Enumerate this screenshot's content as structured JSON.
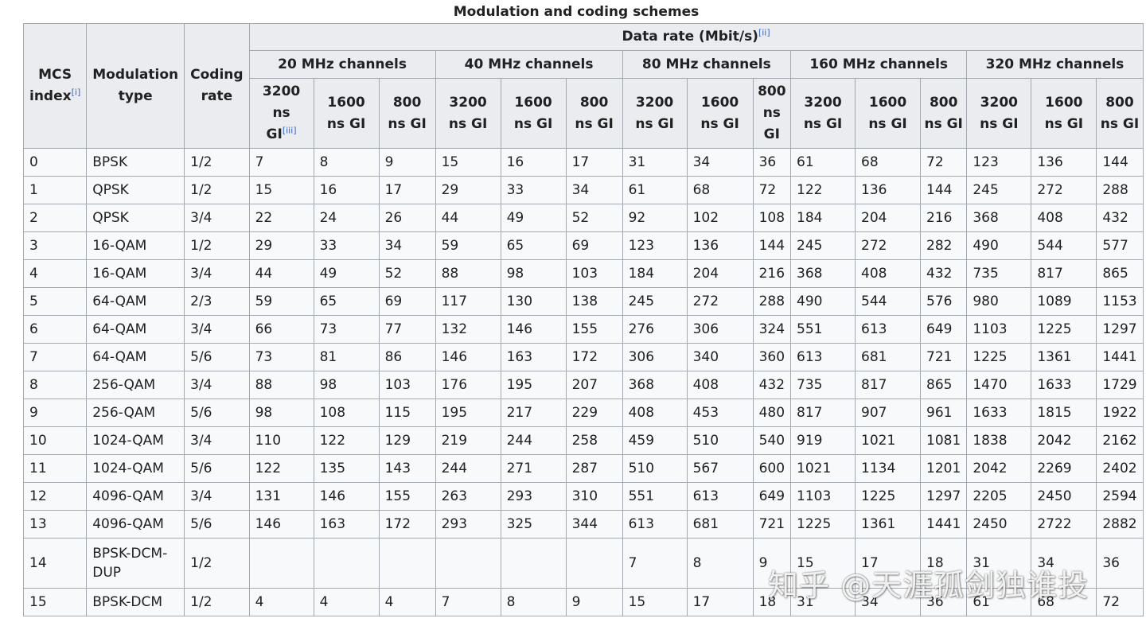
{
  "caption": "Modulation and coding schemes",
  "headers": {
    "mcs_index": "MCS index",
    "mcs_note": "[i]",
    "modulation_type": "Modulation type",
    "coding_rate": "Coding rate",
    "data_rate": "Data rate (Mbit/s)",
    "data_rate_note": "[ii]",
    "channels": [
      "20 MHz channels",
      "40 MHz channels",
      "80 MHz channels",
      "160 MHz channels",
      "320 MHz channels"
    ],
    "gi_3200": "3200 ns GI",
    "gi_3200_note": "[iii]",
    "gi_1600": "1600 ns GI",
    "gi_800": "800 ns GI"
  },
  "rows": [
    [
      "0",
      "BPSK",
      "1/2",
      "7",
      "8",
      "9",
      "15",
      "16",
      "17",
      "31",
      "34",
      "36",
      "61",
      "68",
      "72",
      "123",
      "136",
      "144"
    ],
    [
      "1",
      "QPSK",
      "1/2",
      "15",
      "16",
      "17",
      "29",
      "33",
      "34",
      "61",
      "68",
      "72",
      "122",
      "136",
      "144",
      "245",
      "272",
      "288"
    ],
    [
      "2",
      "QPSK",
      "3/4",
      "22",
      "24",
      "26",
      "44",
      "49",
      "52",
      "92",
      "102",
      "108",
      "184",
      "204",
      "216",
      "368",
      "408",
      "432"
    ],
    [
      "3",
      "16-QAM",
      "1/2",
      "29",
      "33",
      "34",
      "59",
      "65",
      "69",
      "123",
      "136",
      "144",
      "245",
      "272",
      "282",
      "490",
      "544",
      "577"
    ],
    [
      "4",
      "16-QAM",
      "3/4",
      "44",
      "49",
      "52",
      "88",
      "98",
      "103",
      "184",
      "204",
      "216",
      "368",
      "408",
      "432",
      "735",
      "817",
      "865"
    ],
    [
      "5",
      "64-QAM",
      "2/3",
      "59",
      "65",
      "69",
      "117",
      "130",
      "138",
      "245",
      "272",
      "288",
      "490",
      "544",
      "576",
      "980",
      "1089",
      "1153"
    ],
    [
      "6",
      "64-QAM",
      "3/4",
      "66",
      "73",
      "77",
      "132",
      "146",
      "155",
      "276",
      "306",
      "324",
      "551",
      "613",
      "649",
      "1103",
      "1225",
      "1297"
    ],
    [
      "7",
      "64-QAM",
      "5/6",
      "73",
      "81",
      "86",
      "146",
      "163",
      "172",
      "306",
      "340",
      "360",
      "613",
      "681",
      "721",
      "1225",
      "1361",
      "1441"
    ],
    [
      "8",
      "256-QAM",
      "3/4",
      "88",
      "98",
      "103",
      "176",
      "195",
      "207",
      "368",
      "408",
      "432",
      "735",
      "817",
      "865",
      "1470",
      "1633",
      "1729"
    ],
    [
      "9",
      "256-QAM",
      "5/6",
      "98",
      "108",
      "115",
      "195",
      "217",
      "229",
      "408",
      "453",
      "480",
      "817",
      "907",
      "961",
      "1633",
      "1815",
      "1922"
    ],
    [
      "10",
      "1024-QAM",
      "3/4",
      "110",
      "122",
      "129",
      "219",
      "244",
      "258",
      "459",
      "510",
      "540",
      "919",
      "1021",
      "1081",
      "1838",
      "2042",
      "2162"
    ],
    [
      "11",
      "1024-QAM",
      "5/6",
      "122",
      "135",
      "143",
      "244",
      "271",
      "287",
      "510",
      "567",
      "600",
      "1021",
      "1134",
      "1201",
      "2042",
      "2269",
      "2402"
    ],
    [
      "12",
      "4096-QAM",
      "3/4",
      "131",
      "146",
      "155",
      "263",
      "293",
      "310",
      "551",
      "613",
      "649",
      "1103",
      "1225",
      "1297",
      "2205",
      "2450",
      "2594"
    ],
    [
      "13",
      "4096-QAM",
      "5/6",
      "146",
      "163",
      "172",
      "293",
      "325",
      "344",
      "613",
      "681",
      "721",
      "1225",
      "1361",
      "1441",
      "2450",
      "2722",
      "2882"
    ],
    [
      "14",
      "BPSK-DCM-DUP",
      "1/2",
      "",
      "",
      "",
      "",
      "",
      "",
      "7",
      "8",
      "9",
      "15",
      "17",
      "18",
      "31",
      "34",
      "36"
    ],
    [
      "15",
      "BPSK-DCM",
      "1/2",
      "4",
      "4",
      "4",
      "7",
      "8",
      "9",
      "15",
      "17",
      "18",
      "31",
      "34",
      "36",
      "61",
      "68",
      "72"
    ]
  ],
  "watermark": "知乎 @天涯孤剑独谁投"
}
